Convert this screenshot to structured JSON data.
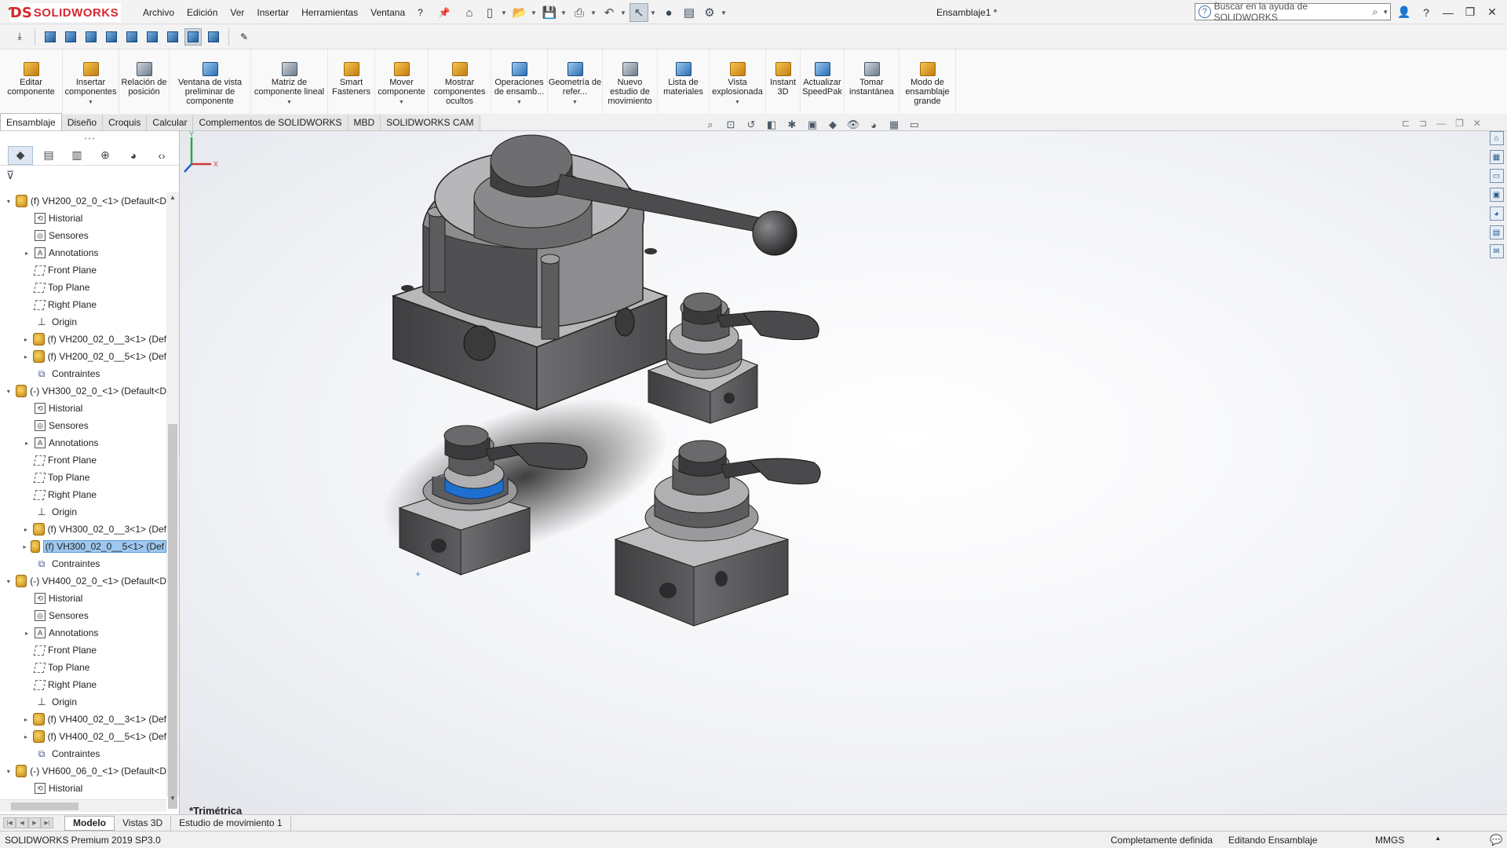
{
  "app": {
    "brand": "SOLIDWORKS",
    "document_title": "Ensamblaje1 *"
  },
  "menu": [
    "Archivo",
    "Edición",
    "Ver",
    "Insertar",
    "Herramientas",
    "Ventana",
    "?"
  ],
  "search": {
    "placeholder": "Buscar en la ayuda de SOLIDWORKS"
  },
  "ribbon": [
    {
      "label": "Editar componente",
      "icon": "edit-component-icon"
    },
    {
      "label": "Insertar componentes",
      "icon": "insert-components-icon",
      "dropdown": true
    },
    {
      "label": "Relación de posición",
      "icon": "mate-icon"
    },
    {
      "label": "Ventana de vista preliminar de componente",
      "icon": "component-preview-icon"
    },
    {
      "label": "Matriz de componente lineal",
      "icon": "linear-pattern-icon",
      "dropdown": true
    },
    {
      "label": "Smart Fasteners",
      "icon": "smart-fasteners-icon"
    },
    {
      "label": "Mover componente",
      "icon": "move-component-icon",
      "dropdown": true
    },
    {
      "label": "Mostrar componentes ocultos",
      "icon": "show-hidden-icon"
    },
    {
      "label": "Operaciones de ensamb...",
      "icon": "assembly-features-icon",
      "dropdown": true
    },
    {
      "label": "Geometría de refer...",
      "icon": "reference-geometry-icon",
      "dropdown": true
    },
    {
      "label": "Nuevo estudio de movimiento",
      "icon": "motion-study-icon"
    },
    {
      "label": "Lista de materiales",
      "icon": "bom-icon"
    },
    {
      "label": "Vista explosionada",
      "icon": "exploded-view-icon",
      "dropdown": true
    },
    {
      "label": "Instant 3D",
      "icon": "instant3d-icon"
    },
    {
      "label": "Actualizar SpeedPak",
      "icon": "speedpak-icon"
    },
    {
      "label": "Tomar instantánea",
      "icon": "snapshot-icon"
    },
    {
      "label": "Modo de ensamblaje grande",
      "icon": "large-assembly-icon"
    }
  ],
  "command_tabs": [
    "Ensamblaje",
    "Diseño",
    "Croquis",
    "Calcular",
    "Complementos de SOLIDWORKS",
    "MBD",
    "SOLIDWORKS CAM"
  ],
  "active_command_tab": "Ensamblaje",
  "tree": [
    {
      "level": 0,
      "expand": "open",
      "icon": "asm",
      "label": "(f) VH200_02_0_<1> (Default<D"
    },
    {
      "level": 1,
      "expand": "",
      "icon": "history",
      "label": "Historial"
    },
    {
      "level": 1,
      "expand": "",
      "icon": "sensor",
      "label": "Sensores"
    },
    {
      "level": 1,
      "expand": "closed",
      "icon": "annot",
      "label": "Annotations"
    },
    {
      "level": 1,
      "expand": "",
      "icon": "plane",
      "label": "Front Plane"
    },
    {
      "level": 1,
      "expand": "",
      "icon": "plane",
      "label": "Top Plane"
    },
    {
      "level": 1,
      "expand": "",
      "icon": "plane",
      "label": "Right Plane"
    },
    {
      "level": 1,
      "expand": "",
      "icon": "origin",
      "label": "Origin"
    },
    {
      "level": 1,
      "expand": "closed",
      "icon": "asm",
      "label": "(f) VH200_02_0__3<1> (Def"
    },
    {
      "level": 1,
      "expand": "closed",
      "icon": "asm",
      "label": "(f) VH200_02_0__5<1> (Def"
    },
    {
      "level": 1,
      "expand": "",
      "icon": "mate",
      "label": "Contraintes"
    },
    {
      "level": 0,
      "expand": "open",
      "icon": "asm",
      "label": "(-) VH300_02_0_<1> (Default<D"
    },
    {
      "level": 1,
      "expand": "",
      "icon": "history",
      "label": "Historial"
    },
    {
      "level": 1,
      "expand": "",
      "icon": "sensor",
      "label": "Sensores"
    },
    {
      "level": 1,
      "expand": "closed",
      "icon": "annot",
      "label": "Annotations"
    },
    {
      "level": 1,
      "expand": "",
      "icon": "plane",
      "label": "Front Plane"
    },
    {
      "level": 1,
      "expand": "",
      "icon": "plane",
      "label": "Top Plane"
    },
    {
      "level": 1,
      "expand": "",
      "icon": "plane",
      "label": "Right Plane"
    },
    {
      "level": 1,
      "expand": "",
      "icon": "origin",
      "label": "Origin"
    },
    {
      "level": 1,
      "expand": "closed",
      "icon": "asm",
      "label": "(f) VH300_02_0__3<1> (Def"
    },
    {
      "level": 1,
      "expand": "closed",
      "icon": "asm",
      "label": "(f) VH300_02_0__5<1> (Def",
      "selected": true
    },
    {
      "level": 1,
      "expand": "",
      "icon": "mate",
      "label": "Contraintes"
    },
    {
      "level": 0,
      "expand": "open",
      "icon": "asm",
      "label": "(-) VH400_02_0_<1> (Default<D"
    },
    {
      "level": 1,
      "expand": "",
      "icon": "history",
      "label": "Historial"
    },
    {
      "level": 1,
      "expand": "",
      "icon": "sensor",
      "label": "Sensores"
    },
    {
      "level": 1,
      "expand": "closed",
      "icon": "annot",
      "label": "Annotations"
    },
    {
      "level": 1,
      "expand": "",
      "icon": "plane",
      "label": "Front Plane"
    },
    {
      "level": 1,
      "expand": "",
      "icon": "plane",
      "label": "Top Plane"
    },
    {
      "level": 1,
      "expand": "",
      "icon": "plane",
      "label": "Right Plane"
    },
    {
      "level": 1,
      "expand": "",
      "icon": "origin",
      "label": "Origin"
    },
    {
      "level": 1,
      "expand": "closed",
      "icon": "asm",
      "label": "(f) VH400_02_0__3<1> (Def"
    },
    {
      "level": 1,
      "expand": "closed",
      "icon": "asm",
      "label": "(f) VH400_02_0__5<1> (Def"
    },
    {
      "level": 1,
      "expand": "",
      "icon": "mate",
      "label": "Contraintes"
    },
    {
      "level": 0,
      "expand": "open",
      "icon": "asm",
      "label": "(-) VH600_06_0_<1> (Default<D"
    },
    {
      "level": 1,
      "expand": "",
      "icon": "history",
      "label": "Historial"
    }
  ],
  "viewport": {
    "view_name": "*Trimétrica",
    "triad": {
      "x": "X",
      "y": "Y"
    }
  },
  "model_tabs": [
    "Modelo",
    "Vistas 3D",
    "Estudio de movimiento 1"
  ],
  "active_model_tab": "Modelo",
  "status": {
    "product": "SOLIDWORKS Premium 2019 SP3.0",
    "definition": "Completamente definida",
    "mode": "Editando Ensamblaje",
    "units": "MMGS"
  },
  "colors": {
    "brand_red": "#d6282f",
    "selection_blue": "#1f6fd0",
    "part_gray": "#5a5a5c"
  }
}
